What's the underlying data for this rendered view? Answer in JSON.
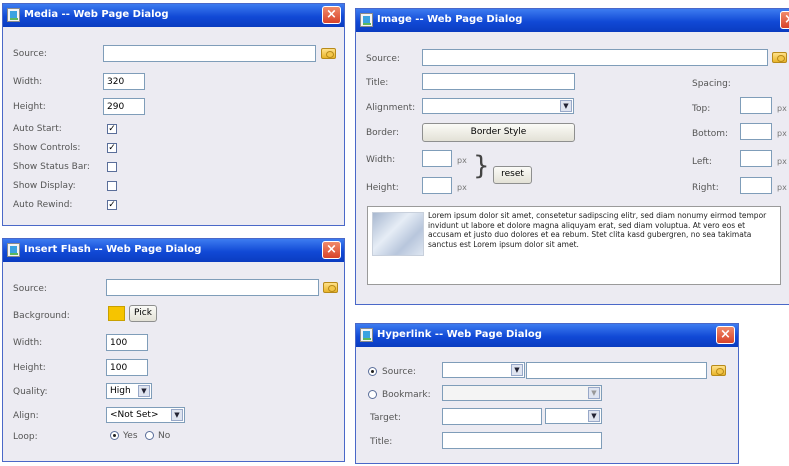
{
  "media": {
    "title": "Media -- Web Page Dialog",
    "close": "×",
    "source_label": "Source:",
    "source_value": "",
    "width_label": "Width:",
    "width_value": "320",
    "height_label": "Height:",
    "height_value": "290",
    "checks": [
      {
        "label": "Auto Start:",
        "checked": true,
        "mark": "✓"
      },
      {
        "label": "Show Controls:",
        "checked": true,
        "mark": "✓"
      },
      {
        "label": "Show Status Bar:",
        "checked": false,
        "mark": ""
      },
      {
        "label": "Show Display:",
        "checked": false,
        "mark": ""
      },
      {
        "label": "Auto Rewind:",
        "checked": true,
        "mark": "✓"
      }
    ]
  },
  "flash": {
    "title": "Insert Flash -- Web Page Dialog",
    "close": "×",
    "source_label": "Source:",
    "source_value": "",
    "background_label": "Background:",
    "background_color": "#f6c400",
    "pick_label": "Pick",
    "width_label": "Width:",
    "width_value": "100",
    "height_label": "Height:",
    "height_value": "100",
    "quality_label": "Quality:",
    "quality_value": "High",
    "align_label": "Align:",
    "align_value": "<Not Set>",
    "loop_label": "Loop:",
    "loop_yes": "Yes",
    "loop_no": "No",
    "loop_selected": "Yes"
  },
  "image": {
    "title": "Image -- Web Page Dialog",
    "close": "×",
    "source_label": "Source:",
    "source_value": "",
    "title_label": "Title:",
    "title_value": "",
    "alignment_label": "Alignment:",
    "alignment_value": "",
    "border_label": "Border:",
    "border_style_button": "Border Style",
    "width_label": "Width:",
    "width_value": "",
    "height_label": "Height:",
    "height_value": "",
    "unit": "px",
    "brace": "}",
    "reset_button": "reset",
    "spacing_label": "Spacing:",
    "top_label": "Top:",
    "bottom_label": "Bottom:",
    "left_label": "Left:",
    "right_label": "Right:",
    "preview_text": "Lorem ipsum dolor sit amet, consetetur sadipscing elitr, sed diam nonumy eirmod tempor invidunt ut labore et dolore magna aliquyam erat, sed diam voluptua. At vero eos et accusam et justo duo dolores et ea rebum. Stet clita kasd gubergren, no sea takimata sanctus est Lorem ipsum dolor sit amet."
  },
  "hyperlink": {
    "title": "Hyperlink -- Web Page Dialog",
    "close": "×",
    "source_label": "Source:",
    "source_protocol": "",
    "source_value": "",
    "bookmark_label": "Bookmark:",
    "bookmark_value": "",
    "target_label": "Target:",
    "target_value": "",
    "target_select": "",
    "title_label": "Title:",
    "title_value": "",
    "mode_selected": "Source"
  }
}
